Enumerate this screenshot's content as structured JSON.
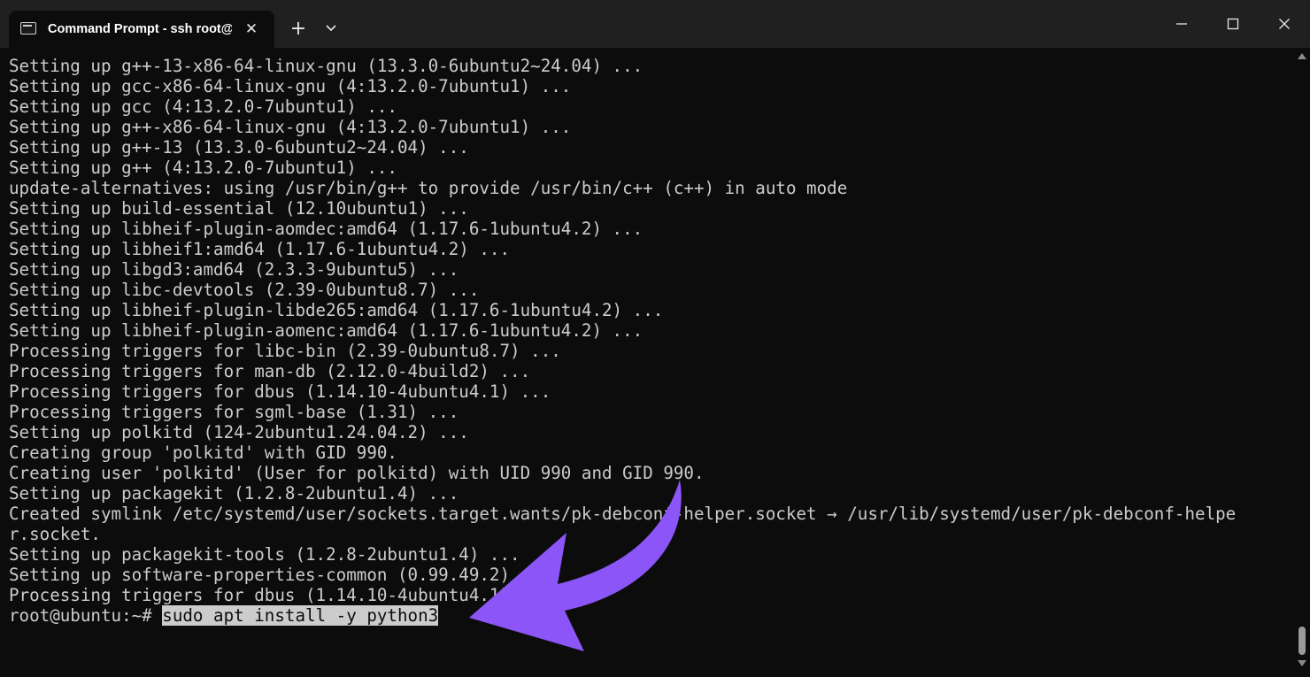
{
  "window": {
    "tab_title": "Command Prompt - ssh  root@",
    "tab_close": "✕",
    "new_tab": "+",
    "icons": {
      "tab": "terminal-icon",
      "dropdown": "chevron-down-icon",
      "minimize": "minimize-icon",
      "maximize": "maximize-icon",
      "close": "close-icon"
    }
  },
  "terminal": {
    "lines": [
      "Setting up g++-13-x86-64-linux-gnu (13.3.0-6ubuntu2~24.04) ...",
      "Setting up gcc-x86-64-linux-gnu (4:13.2.0-7ubuntu1) ...",
      "Setting up gcc (4:13.2.0-7ubuntu1) ...",
      "Setting up g++-x86-64-linux-gnu (4:13.2.0-7ubuntu1) ...",
      "Setting up g++-13 (13.3.0-6ubuntu2~24.04) ...",
      "Setting up g++ (4:13.2.0-7ubuntu1) ...",
      "update-alternatives: using /usr/bin/g++ to provide /usr/bin/c++ (c++) in auto mode",
      "Setting up build-essential (12.10ubuntu1) ...",
      "Setting up libheif-plugin-aomdec:amd64 (1.17.6-1ubuntu4.2) ...",
      "Setting up libheif1:amd64 (1.17.6-1ubuntu4.2) ...",
      "Setting up libgd3:amd64 (2.3.3-9ubuntu5) ...",
      "Setting up libc-devtools (2.39-0ubuntu8.7) ...",
      "Setting up libheif-plugin-libde265:amd64 (1.17.6-1ubuntu4.2) ...",
      "Setting up libheif-plugin-aomenc:amd64 (1.17.6-1ubuntu4.2) ...",
      "Processing triggers for libc-bin (2.39-0ubuntu8.7) ...",
      "Processing triggers for man-db (2.12.0-4build2) ...",
      "Processing triggers for dbus (1.14.10-4ubuntu4.1) ...",
      "Processing triggers for sgml-base (1.31) ...",
      "Setting up polkitd (124-2ubuntu1.24.04.2) ...",
      "Creating group 'polkitd' with GID 990.",
      "Creating user 'polkitd' (User for polkitd) with UID 990 and GID 990.",
      "Setting up packagekit (1.2.8-2ubuntu1.4) ...",
      "Created symlink /etc/systemd/user/sockets.target.wants/pk-debconf-helper.socket → /usr/lib/systemd/user/pk-debconf-helpe",
      "r.socket.",
      "Setting up packagekit-tools (1.2.8-2ubuntu1.4) ...",
      "Setting up software-properties-common (0.99.49.2) ...",
      "Processing triggers for dbus (1.14.10-4ubuntu4.1) ..."
    ],
    "prompt": "root@ubuntu:~# ",
    "command": "sudo apt install -y python3"
  },
  "colors": {
    "terminal_bg": "#0c0c0c",
    "terminal_text": "#cccccc",
    "titlebar_bg": "#202020",
    "annotation_arrow": "#8b55f7"
  }
}
